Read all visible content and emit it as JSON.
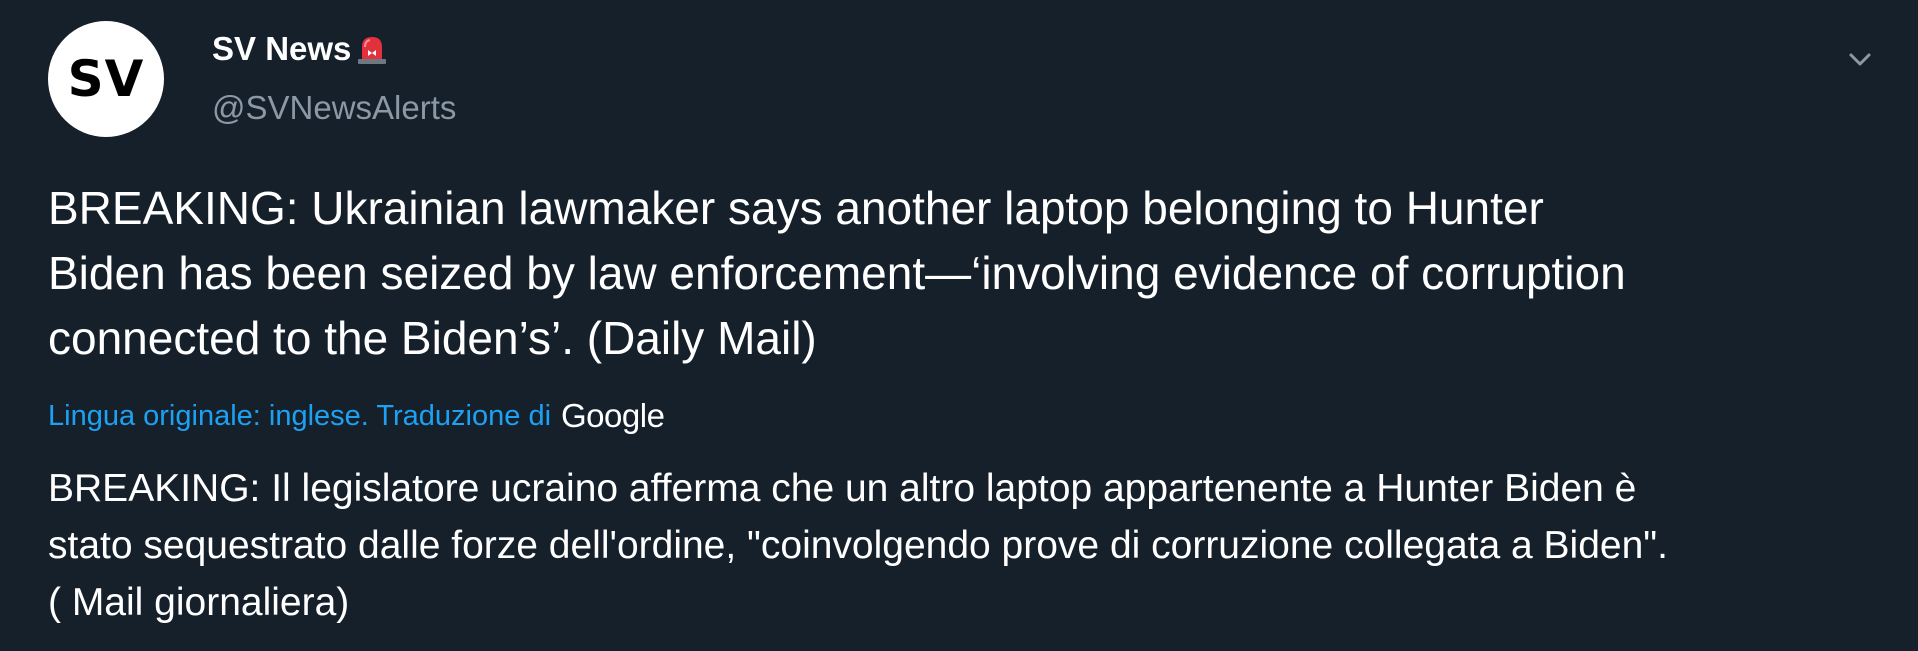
{
  "tweet": {
    "avatar_text": "SV",
    "display_name": "SV News",
    "handle": "@SVNewsAlerts",
    "text_lines": [
      "BREAKING: Ukrainian lawmaker says another laptop belonging to Hunter",
      "Biden has been seized by law enforcement—‘involving evidence of corruption",
      "connected to the Biden’s’. (Daily Mail)"
    ],
    "translation": {
      "label": "Lingua originale: inglese. Traduzione di",
      "provider": "Google",
      "text_lines": [
        "BREAKING: Il legislatore ucraino afferma che un altro laptop appartenente a Hunter Biden è",
        "stato sequestrato dalle forze dell'ordine, \"coinvolgendo prove di corruzione collegata a Biden\".",
        "( Mail giornaliera)"
      ]
    },
    "icons": {
      "verified_emoji": "siren-icon",
      "menu": "chevron-down-icon"
    },
    "colors": {
      "background": "#16202b",
      "link": "#1da1f2",
      "secondary_text": "#8b98a5"
    }
  }
}
